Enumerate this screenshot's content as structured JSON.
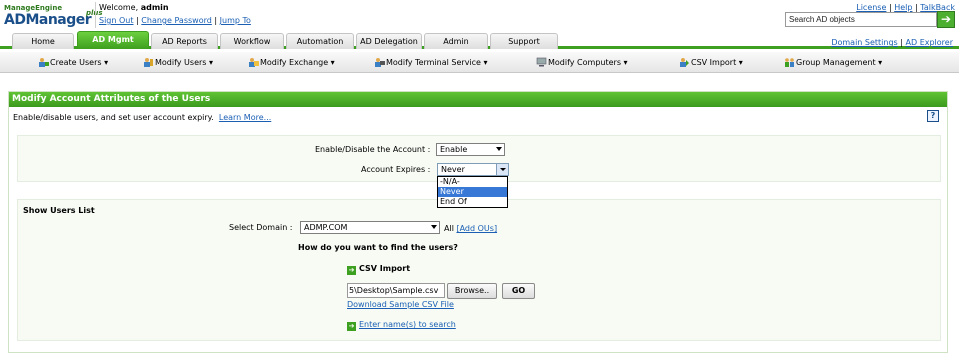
{
  "header": {
    "logo_top": "ManageEngine",
    "logo_main": "ADManager",
    "logo_plus": "plus",
    "welcome_prefix": "Welcome,",
    "user": "admin",
    "sign_out": "Sign Out",
    "change_password": "Change Password",
    "jump_to": "Jump To",
    "license": "License",
    "help": "Help",
    "talkback": "TalkBack",
    "search_placeholder": "Search AD objects"
  },
  "tabs": [
    {
      "label": "Home"
    },
    {
      "label": "AD Mgmt"
    },
    {
      "label": "AD Reports"
    },
    {
      "label": "Workflow"
    },
    {
      "label": "Automation"
    },
    {
      "label": "AD Delegation"
    },
    {
      "label": "Admin"
    },
    {
      "label": "Support"
    }
  ],
  "right_links": {
    "domain_settings": "Domain Settings",
    "ad_explorer": "AD Explorer"
  },
  "submenu": [
    {
      "label": "Create Users",
      "icon": "create-users-icon"
    },
    {
      "label": "Modify Users",
      "icon": "modify-users-icon"
    },
    {
      "label": "Modify Exchange",
      "icon": "modify-exchange-icon"
    },
    {
      "label": "Modify Terminal Service",
      "icon": "terminal-service-icon"
    },
    {
      "label": "Modify Computers",
      "icon": "modify-computers-icon"
    },
    {
      "label": "CSV Import",
      "icon": "csv-import-icon"
    },
    {
      "label": "Group Management",
      "icon": "group-management-icon"
    }
  ],
  "panel": {
    "title": "Modify Account Attributes of the Users",
    "description": "Enable/disable users, and set user account expiry.",
    "learn_more": "Learn More...",
    "help_icon_text": "?",
    "enable_label": "Enable/Disable the Account :",
    "enable_value": "Enable",
    "expires_label": "Account Expires :",
    "expires_value": "Never",
    "expires_options": [
      "-N/A-",
      "Never",
      "End Of"
    ],
    "show_users_title": "Show Users List",
    "select_domain_label": "Select Domain :",
    "domain_value": "ADMP.COM",
    "all_label": "All",
    "add_ous": "[Add OUs]",
    "find_question": "How do you want to find the users?",
    "csv_import": "CSV Import",
    "file_value": "5\\Desktop\\Sample.csv",
    "browse": "Browse..",
    "go": "GO",
    "download_sample": "Download Sample CSV File",
    "enter_names": "Enter name(s) to search"
  },
  "colors": {
    "accent_green": "#3ea020",
    "link_blue": "#1a5fb4",
    "brand_blue": "#1b4f8a"
  }
}
